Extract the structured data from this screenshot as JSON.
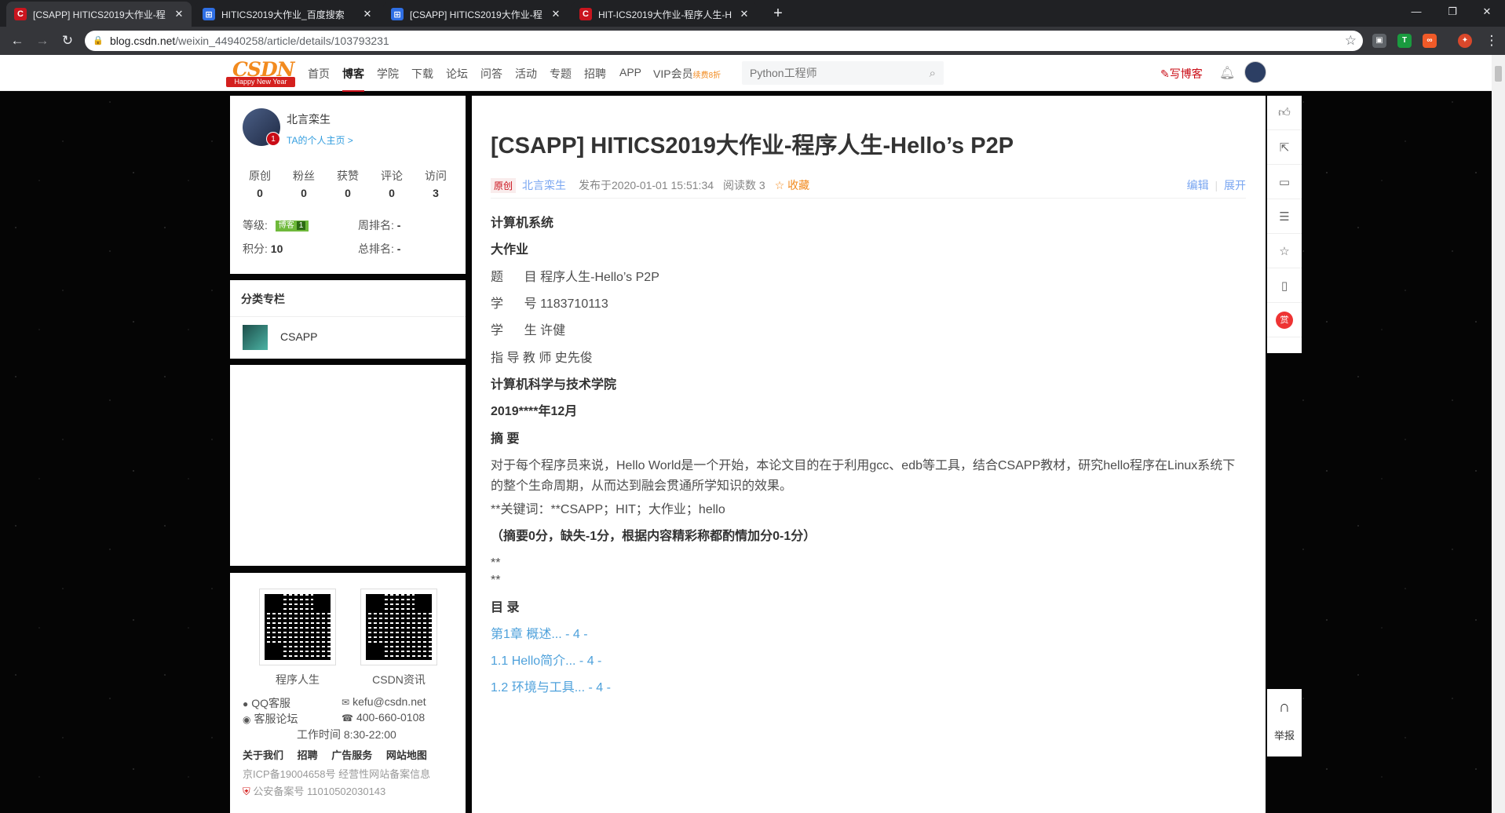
{
  "browser": {
    "tabs": [
      {
        "title": "[CSAPP] HITICS2019大作业-程",
        "favicon": "csdn-icon",
        "active": true
      },
      {
        "title": "HITICS2019大作业_百度搜索",
        "favicon": "baidu-icon",
        "active": false
      },
      {
        "title": "[CSAPP] HITICS2019大作业-程",
        "favicon": "baidu-icon",
        "active": false
      },
      {
        "title": "HIT-ICS2019大作业-程序人生-H",
        "favicon": "csdn-icon",
        "active": false
      }
    ],
    "new_tab": "+",
    "url_host": "blog.csdn.net",
    "url_path": "/weixin_44940258/article/details/103793231"
  },
  "topnav": {
    "logo_text": "CSDN",
    "logo_ribbon": "Happy New Year",
    "links": [
      "首页",
      "博客",
      "学院",
      "下载",
      "论坛",
      "问答",
      "活动",
      "专题",
      "招聘",
      "APP",
      "VIP会员"
    ],
    "active_link": "博客",
    "vip_badge": "续费8折",
    "search_placeholder": "Python工程师",
    "write_blog": "写博客"
  },
  "profile": {
    "username": "北言栾生",
    "home_link": "TA的个人主页 >",
    "level_badge": "1",
    "stats": [
      {
        "label": "原创",
        "value": "0"
      },
      {
        "label": "粉丝",
        "value": "0"
      },
      {
        "label": "获赞",
        "value": "0"
      },
      {
        "label": "评论",
        "value": "0"
      },
      {
        "label": "访问",
        "value": "3"
      }
    ],
    "level_label": "等级:",
    "level_tag": "博客",
    "level_num": "1",
    "points_label": "积分:",
    "points": "10",
    "week_rank_label": "周排名:",
    "week_rank": "-",
    "total_rank_label": "总排名:",
    "total_rank": "-"
  },
  "column": {
    "header": "分类专栏",
    "name": "CSAPP"
  },
  "footer": {
    "qr": [
      "程序人生",
      "CSDN资讯"
    ],
    "qq": "QQ客服",
    "forum": "客服论坛",
    "email": "kefu@csdn.net",
    "phone": "400-660-0108",
    "hours": "工作时间 8:30-22:00",
    "links": [
      "关于我们",
      "招聘",
      "广告服务",
      "网站地图"
    ],
    "icp": "京ICP备19004658号  经营性网站备案信息",
    "police": "公安备案号 11010502030143"
  },
  "article": {
    "title": "[CSAPP] HITICS2019大作业-程序人生-Hello’s P2P",
    "original": "原创",
    "author": "北言栾生",
    "published": "发布于2020-01-01 15:51:34",
    "reads": "阅读数 3",
    "favorite": "☆ 收藏",
    "edit": "编辑",
    "expand": "展开",
    "paragraphs": [
      "计算机系统",
      "大作业",
      "题      目 程序人生-Hello’s P2P",
      "学      号 1183710113",
      "学      生 许健",
      "指 导 教 师 史先俊",
      "计算机科学与技术学院",
      "2019****年12月",
      "摘 要",
      "对于每个程序员来说，Hello World是一个开始，本论文目的在于利用gcc、edb等工具，结合CSAPP教材，研究hello程序在Linux系统下的整个生命周期，从而达到融会贯通所学知识的效果。",
      "**关键词：**CSAPP；HIT；大作业；hello",
      "（摘要0分，缺失-1分，根据内容精彩称都酌情加分0-1分）",
      "**",
      "**",
      "目 录",
      "第1章 概述... - 4 -",
      "1.1 Hello简介... - 4 -",
      "1.2 环境与工具... - 4 -"
    ]
  },
  "tools": {
    "report": "举报",
    "reward": "赏"
  }
}
